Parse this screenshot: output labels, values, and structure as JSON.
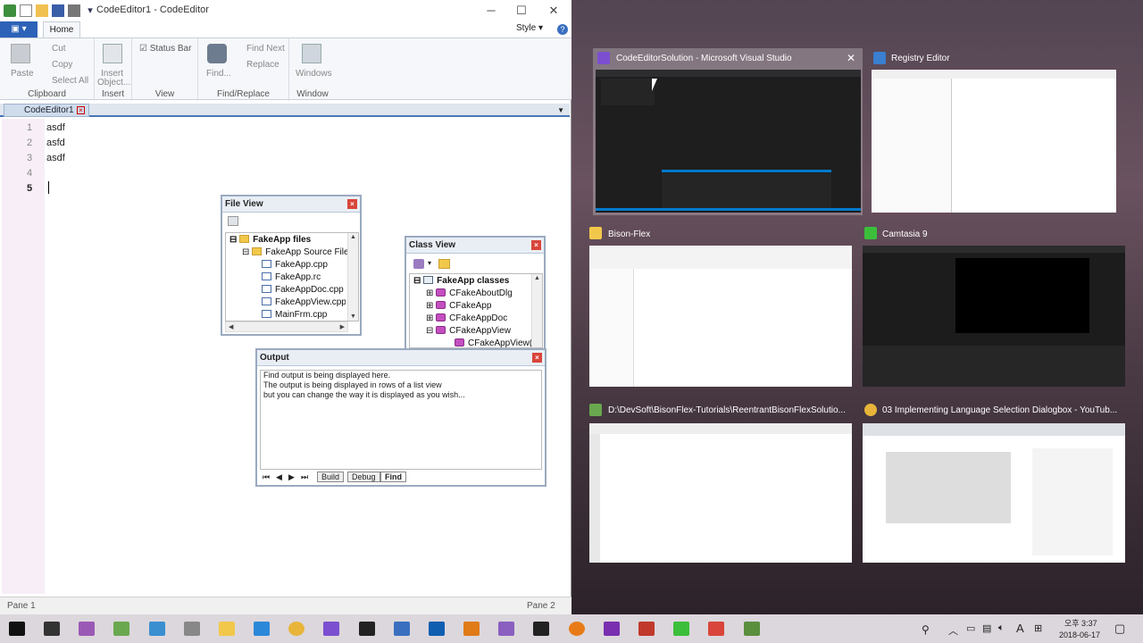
{
  "app": {
    "window_title": "CodeEditor1 - CodeEditor",
    "ribbon": {
      "file_tab": "",
      "tabs": [
        "Home"
      ],
      "style_label": "Style",
      "groups": {
        "clipboard": {
          "label": "Clipboard",
          "paste": "Paste",
          "cut": "Cut",
          "copy": "Copy",
          "select_all": "Select All"
        },
        "insert": {
          "label": "Insert",
          "insert_object_1": "Insert",
          "insert_object_2": "Object..."
        },
        "view": {
          "label": "View",
          "status_bar": "Status Bar"
        },
        "find_replace": {
          "label": "Find/Replace",
          "find": "Find...",
          "find_next": "Find Next",
          "replace": "Replace"
        },
        "window": {
          "label": "Window",
          "windows": "Windows"
        }
      }
    },
    "doc_tab": "CodeEditor1",
    "editor_lines": [
      {
        "num": "1",
        "text": "asdf"
      },
      {
        "num": "2",
        "text": "asfd"
      },
      {
        "num": "3",
        "text": "asdf"
      },
      {
        "num": "4",
        "text": ""
      },
      {
        "num": "5",
        "text": ""
      }
    ],
    "status": {
      "pane1": "Pane 1",
      "pane2": "Pane 2"
    },
    "file_view": {
      "title": "File View",
      "items": [
        "FakeApp files",
        "FakeApp Source Files",
        "FakeApp.cpp",
        "FakeApp.rc",
        "FakeAppDoc.cpp",
        "FakeAppView.cpp",
        "MainFrm.cpp"
      ]
    },
    "class_view": {
      "title": "Class View",
      "items": [
        "FakeApp classes",
        "CFakeAboutDlg",
        "CFakeApp",
        "CFakeAppDoc",
        "CFakeAppView",
        "CFakeAppView()"
      ]
    },
    "output": {
      "title": "Output",
      "lines": [
        "Find output is being displayed here.",
        "The output is being displayed in rows of a list view",
        "but you can change the way it is displayed as you wish..."
      ],
      "tabs": [
        "Build",
        "Debug",
        "Find"
      ]
    }
  },
  "switcher": {
    "windows": [
      {
        "title": "CodeEditorSolution - Microsoft Visual Studio",
        "icon_color": "#7b4fd0"
      },
      {
        "title": "Registry Editor",
        "icon_color": "#3a7fd0"
      },
      {
        "title": "Bison-Flex",
        "icon_color": "#f2c84b"
      },
      {
        "title": "Camtasia 9",
        "icon_color": "#3bbf3b"
      },
      {
        "title": "D:\\DevSoft\\BisonFlex-Tutorials\\ReentrantBisonFlexSolutio...",
        "icon_color": "#6aa84f"
      },
      {
        "title": "03 Implementing Language Selection Dialogbox - YouTub...",
        "icon_color": "#e8b53a"
      }
    ]
  },
  "taskbar": {
    "time": "오후 3:37",
    "date": "2018-06-17",
    "ime": "A"
  }
}
